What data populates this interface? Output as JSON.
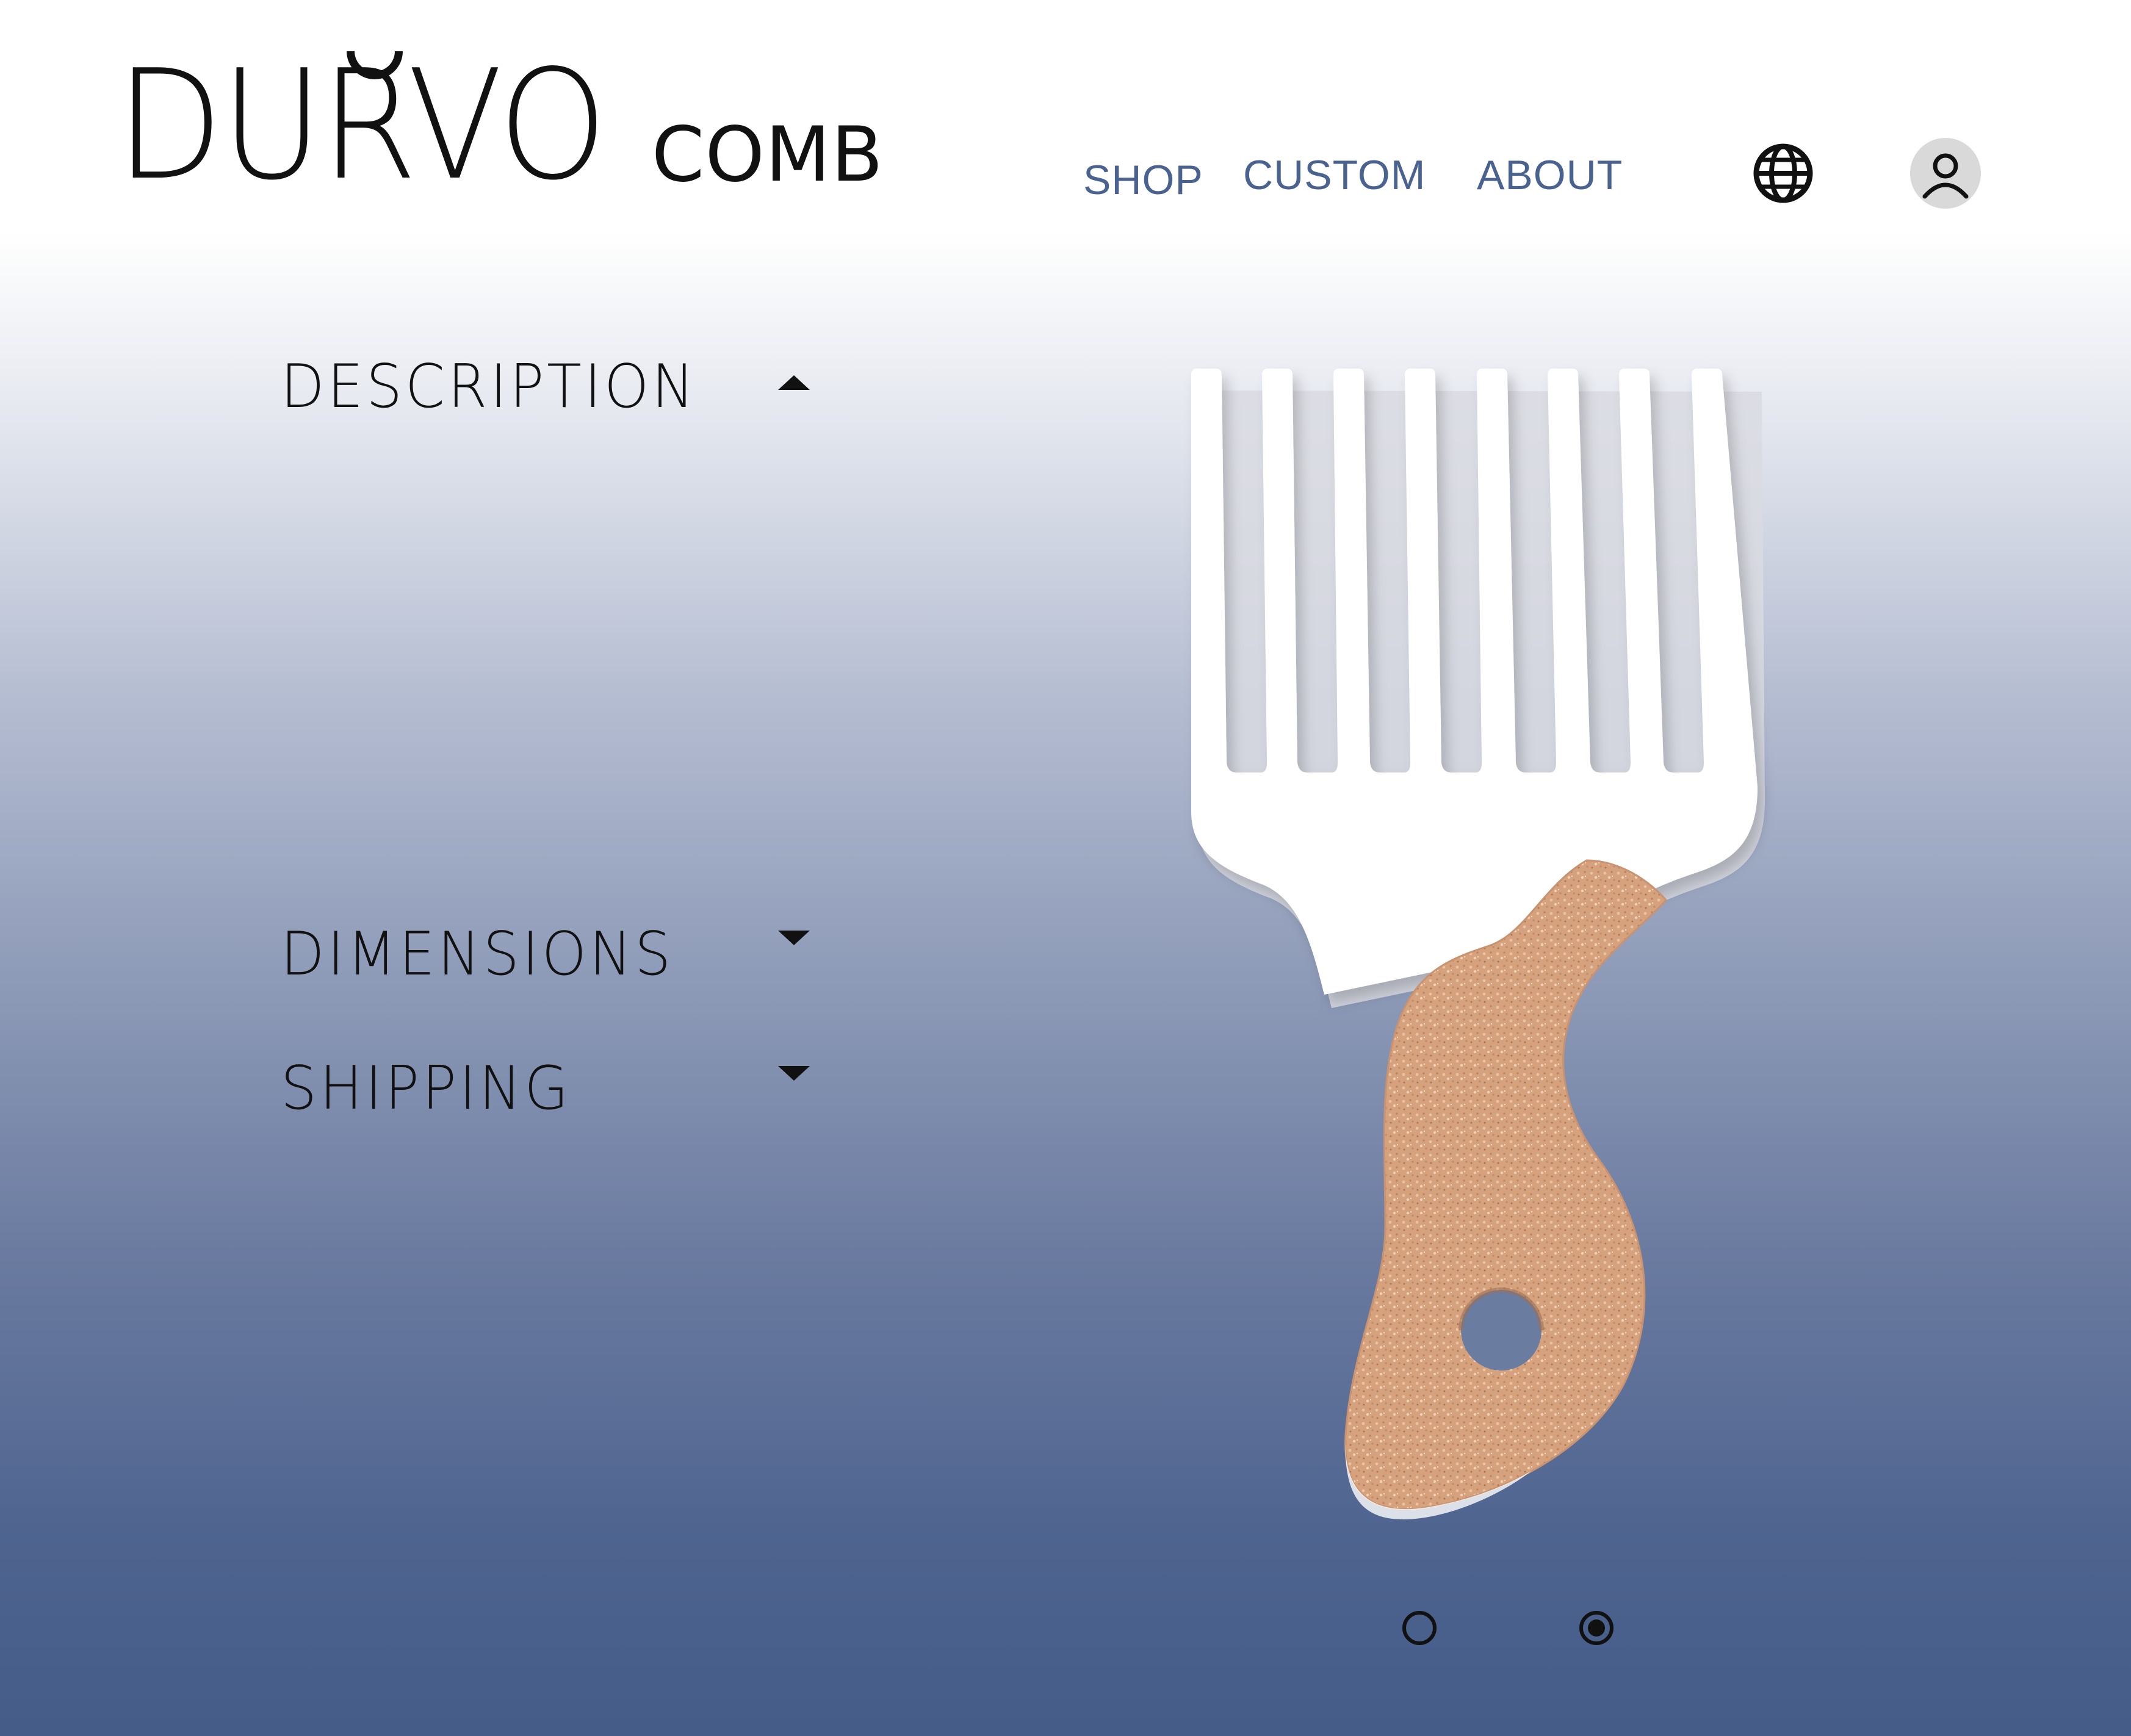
{
  "brand": {
    "name": "DŬRVO",
    "name_base": "DURVO",
    "product": "COMB"
  },
  "nav": {
    "items": [
      {
        "label": "SHOP"
      },
      {
        "label": "CUSTOM"
      },
      {
        "label": "ABOUT"
      }
    ]
  },
  "header_icons": {
    "language": "globe-icon",
    "account": "user-icon"
  },
  "accordion": {
    "sections": [
      {
        "label": "DESCRIPTION",
        "state": "expanded",
        "body": ""
      },
      {
        "label": "DIMENSIONS",
        "state": "collapsed"
      },
      {
        "label": "SHIPPING",
        "state": "collapsed"
      }
    ]
  },
  "product_image": {
    "subject": "afro pick comb with white tines and cork handle"
  },
  "carousel": {
    "total": 2,
    "active": 2
  },
  "colors": {
    "nav_link": "#4a6290",
    "gradient_top": "#ffffff",
    "gradient_bottom": "#455b88",
    "comb_white": "#ffffff",
    "cork": "#d9a882"
  }
}
